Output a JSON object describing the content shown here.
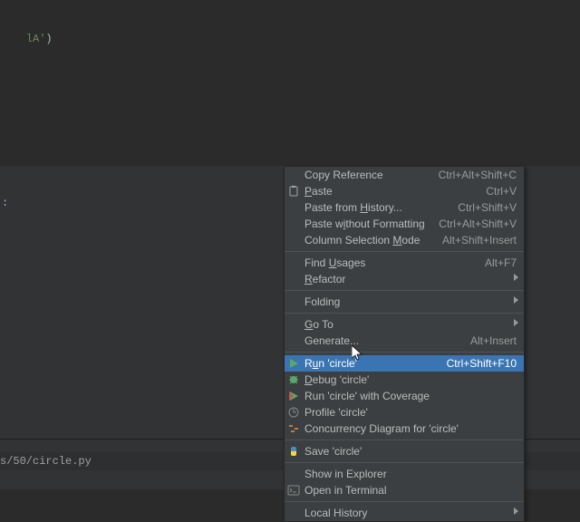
{
  "editor": {
    "code_prefix_paren": "",
    "code_str": "lA'",
    "code_suffix_paren": ")"
  },
  "panel": {
    "run_marker": ":"
  },
  "path": {
    "text": "s/50/circle.py"
  },
  "menu": {
    "copy_ref": "Copy Reference",
    "copy_ref_sc": "Ctrl+Alt+Shift+C",
    "paste": "Paste",
    "paste_sc": "Ctrl+V",
    "paste_hist": "Paste from History...",
    "paste_hist_sc": "Ctrl+Shift+V",
    "paste_nofmt_pre": "Paste w",
    "paste_nofmt_m": "i",
    "paste_nofmt_post": "thout Formatting",
    "paste_nofmt_sc": "Ctrl+Alt+Shift+V",
    "colsel_pre": "Column Selection ",
    "colsel_m": "M",
    "colsel_post": "ode",
    "colsel_sc": "Alt+Shift+Insert",
    "find_usages_pre": "Find ",
    "find_usages_m": "U",
    "find_usages_post": "sages",
    "find_usages_sc": "Alt+F7",
    "refactor_m": "R",
    "refactor_post": "efactor",
    "folding": "Folding",
    "goto_m": "G",
    "goto_post": "o To",
    "generate": "Generate...",
    "generate_sc": "Alt+Insert",
    "run_pre": "R",
    "run_m": "u",
    "run_post": "n 'circle'",
    "run_sc": "Ctrl+Shift+F10",
    "debug_m": "D",
    "debug_post": "ebug 'circle'",
    "coverage": "Run 'circle' with Coverage",
    "profile": "Profile 'circle'",
    "concurrency": "Concurrency Diagram for 'circle'",
    "save": "Save 'circle'",
    "show_ex": "Show in Explorer",
    "open_term": "Open in Terminal",
    "local_hist": "Local History"
  }
}
